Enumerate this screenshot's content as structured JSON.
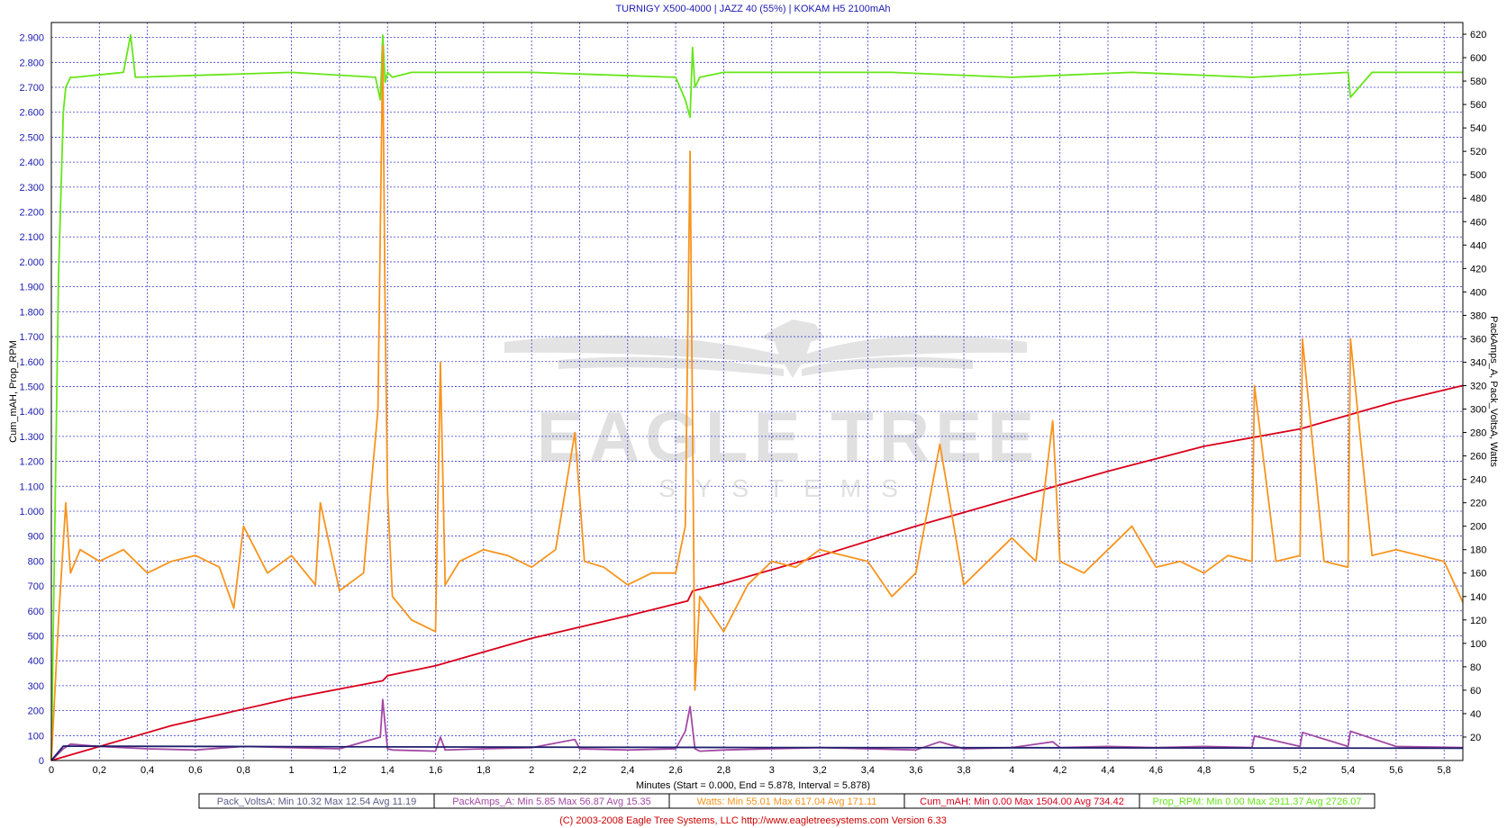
{
  "chart_data": {
    "type": "line",
    "title": "TURNIGY X500-4000 | JAZZ 40 (55%) | KOKAM H5 2100mAh",
    "xlabel": "Minutes (Start = 0.000,  End = 5.878,  Interval =  5.878)",
    "ylabel_left": "Cum_mAH, Prop_RPM",
    "ylabel_right": "PackAmps_A, Pack_VoltsA, Watts",
    "xlim": [
      0,
      5.878
    ],
    "ylim_left": [
      0,
      2960
    ],
    "ylim_right": [
      0,
      630
    ],
    "x_ticks": [
      "0",
      "0,2",
      "0,4",
      "0,6",
      "0,8",
      "1",
      "1,2",
      "1,4",
      "1,6",
      "1,8",
      "2",
      "2,2",
      "2,4",
      "2,6",
      "2,8",
      "3",
      "3,2",
      "3,4",
      "3,6",
      "3,8",
      "4",
      "4,2",
      "4,4",
      "4,6",
      "4,8",
      "5",
      "5,2",
      "5,4",
      "5,6",
      "5,8"
    ],
    "y_left_ticks": [
      "0",
      "100",
      "200",
      "300",
      "400",
      "500",
      "600",
      "700",
      "800",
      "900",
      "1.000",
      "1.100",
      "1.200",
      "1.300",
      "1.400",
      "1.500",
      "1.600",
      "1.700",
      "1.800",
      "1.900",
      "2.000",
      "2.100",
      "2.200",
      "2.300",
      "2.400",
      "2.500",
      "2.600",
      "2.700",
      "2.800",
      "2.900"
    ],
    "y_right_ticks": [
      "20",
      "40",
      "60",
      "80",
      "100",
      "120",
      "140",
      "160",
      "180",
      "200",
      "220",
      "240",
      "260",
      "280",
      "300",
      "320",
      "340",
      "360",
      "380",
      "400",
      "420",
      "440",
      "460",
      "480",
      "500",
      "520",
      "540",
      "560",
      "580",
      "600",
      "620"
    ],
    "grid": true,
    "series": [
      {
        "name": "Prop_RPM",
        "axis": "left",
        "color": "#66e619",
        "x": [
          0,
          0.03,
          0.05,
          0.06,
          0.08,
          0.1,
          0.3,
          0.33,
          0.35,
          1.0,
          1.35,
          1.37,
          1.38,
          1.39,
          1.4,
          1.42,
          1.5,
          2.0,
          2.6,
          2.64,
          2.66,
          2.67,
          2.68,
          2.7,
          2.8,
          3.5,
          4.0,
          4.5,
          5.0,
          5.4,
          5.41,
          5.5,
          5.878
        ],
        "values": [
          0,
          1950,
          2600,
          2700,
          2740,
          2740,
          2760,
          2910,
          2740,
          2760,
          2740,
          2650,
          2910,
          2720,
          2760,
          2740,
          2760,
          2760,
          2740,
          2650,
          2580,
          2860,
          2700,
          2740,
          2760,
          2760,
          2740,
          2760,
          2740,
          2760,
          2660,
          2760,
          2760
        ]
      },
      {
        "name": "Cum_mAH",
        "axis": "left",
        "color": "#d9001b",
        "x": [
          0,
          0.5,
          1.0,
          1.38,
          1.4,
          1.6,
          2.0,
          2.4,
          2.65,
          2.67,
          2.8,
          3.2,
          3.6,
          4.0,
          4.4,
          4.8,
          5.2,
          5.6,
          5.878
        ],
        "values": [
          0,
          140,
          250,
          320,
          340,
          380,
          490,
          580,
          640,
          680,
          710,
          820,
          940,
          1050,
          1160,
          1260,
          1330,
          1440,
          1504
        ]
      },
      {
        "name": "Watts",
        "axis": "right",
        "color": "#f7941d",
        "x": [
          0,
          0.03,
          0.06,
          0.08,
          0.12,
          0.2,
          0.3,
          0.4,
          0.5,
          0.6,
          0.7,
          0.76,
          0.8,
          0.9,
          1.0,
          1.1,
          1.12,
          1.2,
          1.3,
          1.36,
          1.38,
          1.39,
          1.4,
          1.42,
          1.5,
          1.6,
          1.62,
          1.64,
          1.7,
          1.8,
          1.9,
          2.0,
          2.1,
          2.18,
          2.22,
          2.3,
          2.4,
          2.5,
          2.6,
          2.64,
          2.66,
          2.68,
          2.7,
          2.8,
          2.9,
          3.0,
          3.1,
          3.2,
          3.3,
          3.4,
          3.5,
          3.6,
          3.7,
          3.8,
          3.9,
          4.0,
          4.1,
          4.17,
          4.2,
          4.3,
          4.4,
          4.5,
          4.6,
          4.7,
          4.8,
          4.9,
          5.0,
          5.01,
          5.1,
          5.2,
          5.21,
          5.3,
          5.4,
          5.41,
          5.5,
          5.6,
          5.7,
          5.8,
          5.878
        ],
        "values": [
          0,
          120,
          220,
          160,
          180,
          170,
          180,
          160,
          170,
          175,
          165,
          130,
          200,
          160,
          175,
          150,
          220,
          145,
          160,
          300,
          610,
          380,
          230,
          140,
          120,
          110,
          340,
          150,
          170,
          180,
          175,
          165,
          180,
          280,
          170,
          165,
          150,
          160,
          160,
          200,
          520,
          60,
          140,
          110,
          150,
          170,
          165,
          180,
          175,
          170,
          140,
          160,
          270,
          150,
          170,
          190,
          170,
          290,
          170,
          160,
          180,
          200,
          165,
          170,
          160,
          175,
          170,
          320,
          170,
          175,
          360,
          170,
          165,
          360,
          175,
          180,
          175,
          170,
          135
        ]
      },
      {
        "name": "PackAmps_A",
        "axis": "right",
        "color": "#a349a4",
        "x": [
          0,
          0.05,
          0.08,
          0.2,
          0.4,
          0.6,
          0.8,
          1.0,
          1.2,
          1.37,
          1.38,
          1.39,
          1.4,
          1.42,
          1.6,
          1.62,
          1.64,
          1.8,
          2.0,
          2.18,
          2.2,
          2.4,
          2.6,
          2.64,
          2.66,
          2.68,
          2.7,
          2.8,
          3.0,
          3.2,
          3.4,
          3.6,
          3.7,
          3.8,
          4.0,
          4.17,
          4.2,
          4.4,
          4.6,
          4.8,
          5.0,
          5.01,
          5.2,
          5.21,
          5.4,
          5.41,
          5.6,
          5.878
        ],
        "values": [
          0,
          10,
          14,
          12,
          10,
          9,
          12,
          11,
          10,
          20,
          52,
          30,
          10,
          9,
          8,
          20,
          9,
          10,
          11,
          18,
          10,
          9,
          10,
          25,
          46,
          10,
          8,
          9,
          10,
          11,
          10,
          9,
          16,
          10,
          11,
          16,
          11,
          12,
          11,
          12,
          11,
          21,
          12,
          24,
          12,
          25,
          12,
          11
        ]
      },
      {
        "name": "Pack_VoltsA",
        "axis": "right",
        "color": "#1f1f6b",
        "x": [
          0,
          0.05,
          0.1,
          1.0,
          2.0,
          3.0,
          4.0,
          5.0,
          5.878
        ],
        "values": [
          0,
          12.3,
          12.2,
          11.8,
          11.4,
          11.1,
          10.9,
          10.7,
          10.5
        ]
      }
    ],
    "legend": {
      "placement": "bottom",
      "items": [
        {
          "text": "Pack_VoltsA:  Min 10.32   Max 12.54   Avg 11.19",
          "color": "#5c5c8a"
        },
        {
          "text": "PackAmps_A:  Min 5.85   Max 56.87   Avg 15.35",
          "color": "#a349a4"
        },
        {
          "text": "Watts:  Min 55.01   Max 617.04   Avg 171.11",
          "color": "#f7941d"
        },
        {
          "text": "Cum_mAH:  Min 0.00   Max 1504.00   Avg 734.42",
          "color": "#d9001b"
        },
        {
          "text": "Prop_RPM:  Min 0.00   Max 2911.37   Avg 2726.07",
          "color": "#66e619"
        }
      ]
    },
    "watermark": {
      "line1": "EAGLE TREE",
      "line2": "SYSTEMS"
    },
    "footer": "(C) 2003-2008 Eagle Tree Systems, LLC      http://www.eagletreesystems.com      Version 6.33"
  },
  "colors": {
    "grid": "#3b3bd0",
    "plot_border": "#000000",
    "axis_text": "#1a1ab0",
    "title": "#1a1ab0",
    "footer": "#cc0000"
  }
}
